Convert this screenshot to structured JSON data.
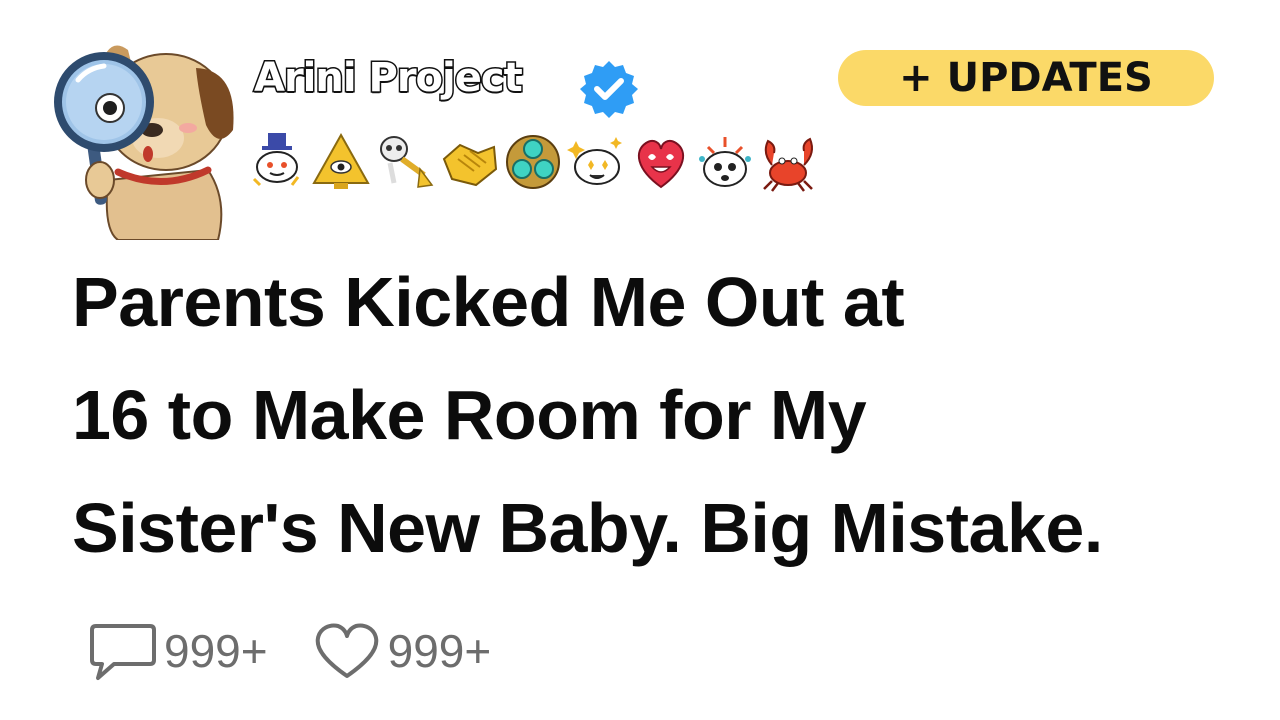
{
  "post": {
    "channel_name": "Arini Project",
    "verified": true,
    "updates_label": "+ UPDATES",
    "title_lines": [
      "Parents Kicked Me Out at",
      "16 to Make Room for My",
      "Sister's New Baby. Big Mistake."
    ]
  },
  "awards": [
    {
      "icon": "snoo-top-hat-award-icon"
    },
    {
      "icon": "golden-pyramid-eye-award-icon"
    },
    {
      "icon": "skeleton-trumpet-award-icon"
    },
    {
      "icon": "golden-handshake-award-icon"
    },
    {
      "icon": "gem-trio-award-icon"
    },
    {
      "icon": "sparkly-snoo-award-icon"
    },
    {
      "icon": "heart-eyes-award-icon"
    },
    {
      "icon": "mind-blown-snoo-award-icon"
    },
    {
      "icon": "dancing-crab-award-icon"
    }
  ],
  "stats": {
    "comments_count": "999+",
    "likes_count": "999+"
  },
  "colors": {
    "updates_bg": "#fbd968",
    "verified_blue": "#2f9df5",
    "stat_gray": "#6d6d6d",
    "title_text": "#0c0c0c"
  }
}
